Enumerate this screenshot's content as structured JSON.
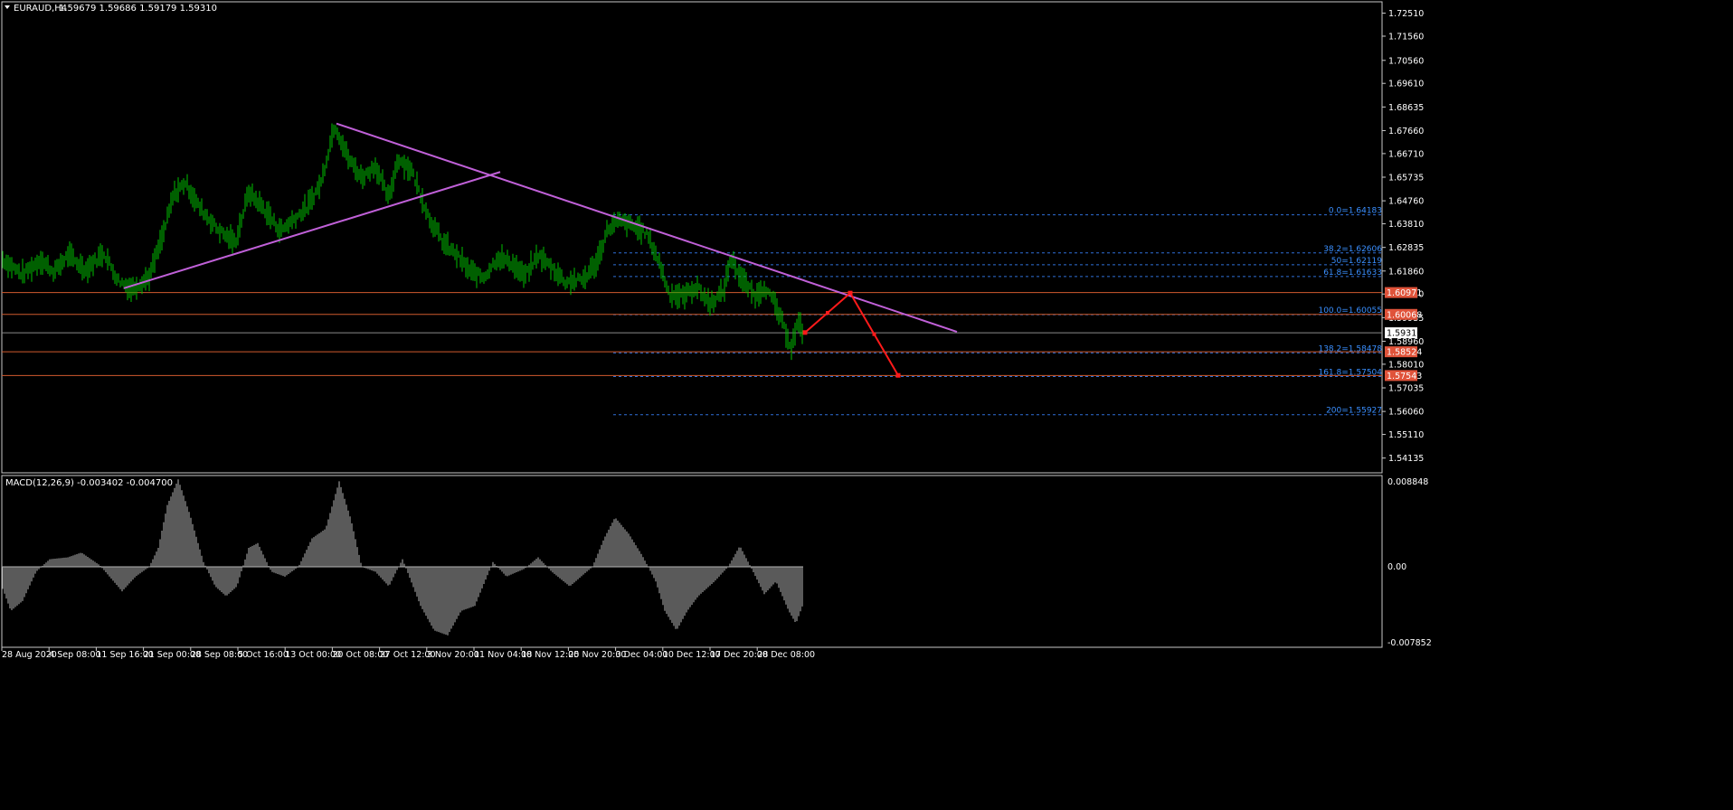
{
  "header": {
    "symbol": "EURAUD,H4",
    "ohlc": "1.59679 1.59686 1.59179 1.59310"
  },
  "colors": {
    "background": "#000000",
    "candle": "#00c000",
    "trendline": "#c060d8",
    "level_line": "#d05a2e",
    "fib_line": "#2f6fd8",
    "fib_text": "#3a8fff",
    "projection": "#ff1a1a",
    "macd_hist": "#b4b4b4",
    "price_tag_bg": "#e0533a",
    "current_tag_bg": "#ffffff",
    "axis": "#c8c8c8"
  },
  "price_axis": {
    "min": 1.5375,
    "max": 1.7268,
    "ticks": [
      "1.72510",
      "1.71560",
      "1.70560",
      "1.69610",
      "1.68635",
      "1.67660",
      "1.66710",
      "1.65735",
      "1.64760",
      "1.63810",
      "1.62835",
      "1.61860",
      "1.60910",
      "1.59935",
      "1.58960",
      "1.58010",
      "1.57035",
      "1.56060",
      "1.55110",
      "1.54135"
    ]
  },
  "price_tags": [
    {
      "text": "1.60971",
      "kind": "level"
    },
    {
      "text": "1.60068",
      "kind": "level"
    },
    {
      "text": "1.59310",
      "kind": "current"
    },
    {
      "text": "1.58524",
      "kind": "level"
    },
    {
      "text": "1.57543",
      "kind": "level"
    }
  ],
  "fibonacci": [
    {
      "label": "0.0=1.64183",
      "price": 1.64183
    },
    {
      "label": "38.2=1.62606",
      "price": 1.62606
    },
    {
      "label": "50=1.62119",
      "price": 1.62119
    },
    {
      "label": "61.8=1.61633",
      "price": 1.61633
    },
    {
      "label": "100.0=1.60055",
      "price": 1.60055
    },
    {
      "label": "138.2=1.58478",
      "price": 1.58478
    },
    {
      "label": "161.8=1.57504",
      "price": 1.57504
    },
    {
      "label": "200=1.55927",
      "price": 1.55927
    }
  ],
  "horizontal_levels": [
    1.60971,
    1.60068,
    1.58524,
    1.57543
  ],
  "current_price": 1.5931,
  "time_axis": [
    "28 Aug 2020",
    "4 Sep 08:00",
    "11 Sep 16:00",
    "21 Sep 00:00",
    "28 Sep 08:00",
    "5 Oct 16:00",
    "13 Oct 00:00",
    "20 Oct 08:00",
    "27 Oct 12:00",
    "3 Nov 20:00",
    "11 Nov 04:00",
    "18 Nov 12:00",
    "25 Nov 20:00",
    "3 Dec 04:00",
    "10 Dec 12:00",
    "17 Dec 20:00",
    "28 Dec 08:00"
  ],
  "macd": {
    "label": "MACD(12,26,9) -0.003402 -0.004700",
    "axis_top": "0.008848",
    "axis_zero": "0.00",
    "axis_bottom": "-0.007852",
    "max": 0.008848,
    "min": -0.007852
  },
  "chart_data": {
    "type": "candlestick",
    "symbol": "EURAUD",
    "timeframe": "H4",
    "price_path": [
      [
        0,
        1.624
      ],
      [
        25,
        1.617
      ],
      [
        45,
        1.623
      ],
      [
        60,
        1.618
      ],
      [
        75,
        1.625
      ],
      [
        95,
        1.619
      ],
      [
        115,
        1.626
      ],
      [
        130,
        1.615
      ],
      [
        145,
        1.611
      ],
      [
        165,
        1.616
      ],
      [
        180,
        1.633
      ],
      [
        192,
        1.65
      ],
      [
        205,
        1.655
      ],
      [
        220,
        1.645
      ],
      [
        240,
        1.636
      ],
      [
        260,
        1.63
      ],
      [
        275,
        1.651
      ],
      [
        290,
        1.645
      ],
      [
        310,
        1.635
      ],
      [
        325,
        1.64
      ],
      [
        340,
        1.645
      ],
      [
        355,
        1.655
      ],
      [
        370,
        1.679
      ],
      [
        385,
        1.665
      ],
      [
        400,
        1.657
      ],
      [
        415,
        1.662
      ],
      [
        430,
        1.648
      ],
      [
        440,
        1.665
      ],
      [
        455,
        1.66
      ],
      [
        465,
        1.65
      ],
      [
        475,
        1.64
      ],
      [
        490,
        1.63
      ],
      [
        505,
        1.625
      ],
      [
        520,
        1.618
      ],
      [
        535,
        1.616
      ],
      [
        550,
        1.624
      ],
      [
        565,
        1.622
      ],
      [
        580,
        1.616
      ],
      [
        595,
        1.625
      ],
      [
        610,
        1.62
      ],
      [
        625,
        1.614
      ],
      [
        645,
        1.615
      ],
      [
        660,
        1.622
      ],
      [
        672,
        1.636
      ],
      [
        685,
        1.639
      ],
      [
        700,
        1.637
      ],
      [
        715,
        1.634
      ],
      [
        728,
        1.623
      ],
      [
        740,
        1.609
      ],
      [
        755,
        1.608
      ],
      [
        770,
        1.612
      ],
      [
        785,
        1.605
      ],
      [
        800,
        1.61
      ],
      [
        808,
        1.624
      ],
      [
        820,
        1.615
      ],
      [
        835,
        1.608
      ],
      [
        845,
        1.612
      ],
      [
        855,
        1.606
      ],
      [
        865,
        1.597
      ],
      [
        875,
        1.587
      ],
      [
        882,
        1.597
      ],
      [
        888,
        1.593
      ]
    ],
    "macd_path": [
      [
        0,
        -0.0015
      ],
      [
        12,
        -0.0045
      ],
      [
        25,
        -0.0035
      ],
      [
        40,
        -0.0005
      ],
      [
        55,
        0.0008
      ],
      [
        75,
        0.001
      ],
      [
        90,
        0.0015
      ],
      [
        110,
        0.0002
      ],
      [
        135,
        -0.0025
      ],
      [
        150,
        -0.001
      ],
      [
        165,
        0.0
      ],
      [
        175,
        0.002
      ],
      [
        185,
        0.0065
      ],
      [
        197,
        0.0092
      ],
      [
        210,
        0.0055
      ],
      [
        225,
        0.0005
      ],
      [
        238,
        -0.002
      ],
      [
        250,
        -0.003
      ],
      [
        262,
        -0.002
      ],
      [
        275,
        0.002
      ],
      [
        285,
        0.0025
      ],
      [
        300,
        -0.0005
      ],
      [
        315,
        -0.001
      ],
      [
        330,
        0.0
      ],
      [
        345,
        0.003
      ],
      [
        360,
        0.004
      ],
      [
        375,
        0.009
      ],
      [
        388,
        0.005
      ],
      [
        400,
        0.0
      ],
      [
        415,
        -0.0005
      ],
      [
        430,
        -0.002
      ],
      [
        445,
        0.0008
      ],
      [
        465,
        -0.004
      ],
      [
        480,
        -0.0065
      ],
      [
        495,
        -0.007
      ],
      [
        510,
        -0.0045
      ],
      [
        525,
        -0.004
      ],
      [
        545,
        0.0005
      ],
      [
        560,
        -0.001
      ],
      [
        580,
        -0.0002
      ],
      [
        595,
        0.001
      ],
      [
        610,
        -0.0005
      ],
      [
        630,
        -0.002
      ],
      [
        655,
        0.0
      ],
      [
        668,
        0.003
      ],
      [
        680,
        0.0052
      ],
      [
        695,
        0.0035
      ],
      [
        710,
        0.0012
      ],
      [
        725,
        -0.0015
      ],
      [
        735,
        -0.0045
      ],
      [
        748,
        -0.0065
      ],
      [
        760,
        -0.0045
      ],
      [
        772,
        -0.003
      ],
      [
        790,
        -0.0015
      ],
      [
        805,
        0.0
      ],
      [
        818,
        0.0022
      ],
      [
        830,
        0.0
      ],
      [
        845,
        -0.0028
      ],
      [
        858,
        -0.0015
      ],
      [
        872,
        -0.0045
      ],
      [
        880,
        -0.0058
      ],
      [
        888,
        -0.0038
      ]
    ],
    "trendlines": [
      {
        "from": [
          137,
          1.6115
        ],
        "to": [
          553,
          1.6595
        ]
      },
      {
        "from": [
          372,
          1.6795
        ],
        "to": [
          1058,
          1.5935
        ]
      }
    ],
    "projection": [
      [
        890,
        1.5932
      ],
      [
        940,
        1.6095
      ],
      [
        993,
        1.5755
      ]
    ]
  }
}
